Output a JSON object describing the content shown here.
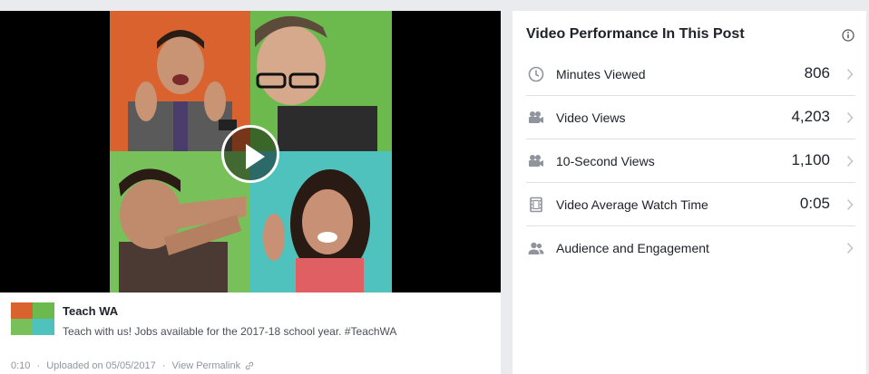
{
  "video": {
    "duration": "0:10",
    "play_icon": "play-icon"
  },
  "post": {
    "page_name": "Teach WA",
    "text": "Teach with us! Jobs available for the 2017-18 school year. #TeachWA",
    "uploaded": "Uploaded on 05/05/2017",
    "separator": "·",
    "permalink_label": "View Permalink",
    "permalink_icon": "link-icon"
  },
  "performance": {
    "title": "Video Performance In This Post",
    "info_icon": "info-icon",
    "metrics": [
      {
        "icon": "clock-icon",
        "label": "Minutes Viewed",
        "value": "806"
      },
      {
        "icon": "video-camera-icon",
        "label": "Video Views",
        "value": "4,203"
      },
      {
        "icon": "video-camera-icon",
        "label": "10-Second Views",
        "value": "1,100"
      },
      {
        "icon": "film-icon",
        "label": "Video Average Watch Time",
        "value": "0:05"
      },
      {
        "icon": "people-icon",
        "label": "Audience and Engagement",
        "value": ""
      }
    ]
  },
  "colors": {
    "background": "#e9ebee",
    "tile_orange": "#d9622e",
    "tile_green": "#6cba4e",
    "tile_green_2": "#77c05a",
    "tile_teal": "#4fc2bd",
    "icon_gray": "#90949c",
    "text_dark": "#1d2129"
  }
}
